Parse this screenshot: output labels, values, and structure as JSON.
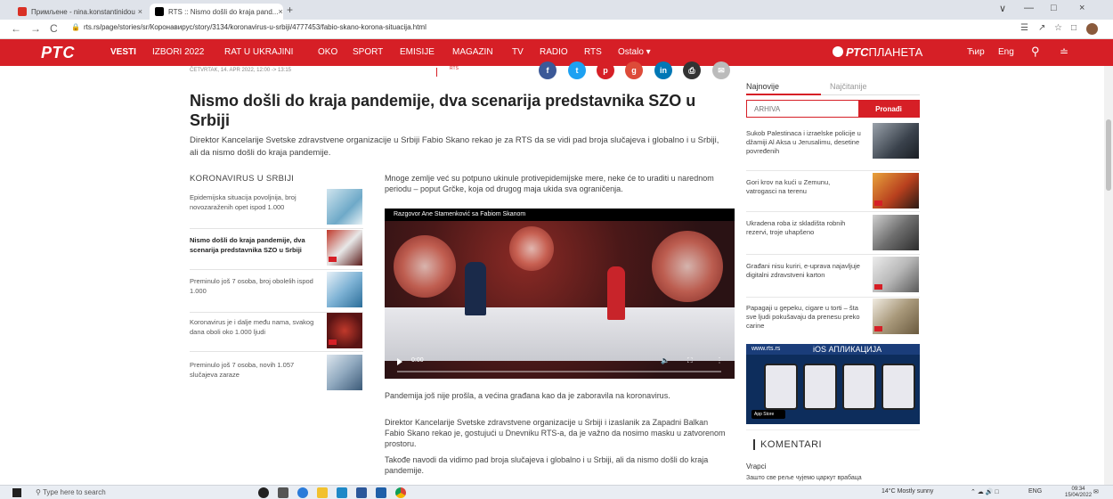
{
  "browser": {
    "tabs": [
      {
        "title": "Примљене - nina.konstantinidou",
        "favicon_color": "#d93025",
        "active": false
      },
      {
        "title": "RTS :: Nismo došli do kraja pand...",
        "favicon_color": "#000000",
        "active": true
      }
    ],
    "url": "rts.rs/page/stories/sr/Коронавирус/story/3134/koronavirus-u-srbiji/4777453/fabio-skano-korona-situacija.html",
    "new_tab": "+",
    "tab_close": "×",
    "nav": {
      "back": "←",
      "forward": "→",
      "reload": "C"
    },
    "window_controls": {
      "min": "—",
      "max": "□",
      "close": "×",
      "down": "∨"
    }
  },
  "site": {
    "logo": "РТС",
    "menu": [
      "VESTI",
      "IZBORI 2022",
      "RAT U UKRAJINI",
      "OKO",
      "SPORT",
      "EMISIJE",
      "MAGAZIN",
      "TV",
      "RADIO",
      "RTS",
      "Ostalo ▾"
    ],
    "active_menu": "VESTI",
    "planeta_brand": "РТС",
    "planeta_suffix": "ПЛАНЕТА",
    "lang_cyr": "Ћир",
    "lang_eng": "Eng",
    "accent_color": "#d61f26"
  },
  "article": {
    "dateline": "ČETVRTAK, 14. APR 2022, 12:00 -> 13:15",
    "share_label": "RTS",
    "share_icons": [
      "facebook-icon",
      "twitter-icon",
      "pinterest-icon",
      "googleplus-icon",
      "linkedin-icon",
      "print-icon",
      "email-icon"
    ],
    "headline": "Nismo došli do kraja pandemije, dva scenarija predstavnika SZO u Srbiji",
    "lead": "Direktor Kancelarije Svetske zdravstvene organizacije u Srbiji Fabio Skano rekao je za RTS da se vidi pad broja slučajeva i globalno i u Srbiji, ali da nismo došli do kraja pandemije.",
    "intro": "Mnoge zemlje već su potpuno ukinule protivepidemijske mere, neke će to uraditi u narednom periodu – poput Grčke, koja od drugog maja ukida sva ograničenja.",
    "video": {
      "title": "Razgovor Ane Stamenković sa Fabiom Skanom",
      "time": "0:00"
    },
    "paragraphs": [
      "Pandemija još nije prošla, a većina građana kao da je zaboravila na koronavirus.",
      "Direktor Kancelarije Svetske zdravstvene organizacije u Srbiji i izaslanik za Zapadni Balkan Fabio Skano rekao je, gostujući u Dnevniku RTS-a, da je važno da nosimo masku u zatvorenom prostoru.",
      "Takođe navodi da vidimo pad broja slučajeva i globalno i u Srbiji, ali da nismo došli do kraja pandemije."
    ]
  },
  "related": {
    "title": "KORONAVIRUS U SRBIJI",
    "items": [
      {
        "text": "Epidemijska situacija povoljnija, broj novozaraženih opet ispod 1.000",
        "bold": false
      },
      {
        "text": "Nismo došli do kraja pandemije, dva scenarija predstavnika SZO u Srbiji",
        "bold": true
      },
      {
        "text": "Preminulo još 7 osoba, broj obolelih ispod 1.000",
        "bold": false
      },
      {
        "text": "Koronavirus je i dalje među nama, svakog dana oboli oko 1.000 ljudi",
        "bold": false
      },
      {
        "text": "Preminulo još 7 osoba, novih 1.057 slučajeva zaraze",
        "bold": false
      }
    ]
  },
  "sidebar": {
    "tab_latest": "Najnovije",
    "tab_most_read": "Najčitanije",
    "archive_placeholder": "ARHIVA",
    "archive_button": "Pronađi",
    "news": [
      "Sukob Palestinaca i izraelske policije u džamiji Al Aksa u Jerusalimu, desetine povređenih",
      "Gori krov na kući u Zemunu, vatrogasci na terenu",
      "Ukradena roba iz skladišta robnih rezervi, troje uhapšeno",
      "Građani nisu kuriri, e-uprava najavljuje digitalni zdravstveni karton",
      "Papagaji u gepeku, cigare u torti – šta sve ljudi pokušavaju da prenesu preko carine"
    ],
    "ios": {
      "site": "www.rts.rs",
      "title": "iOS АПЛИКАЦИЈА",
      "store": "App Store"
    },
    "comments_title": "KOMENTARI",
    "comment_author": "Vrapci",
    "comment_text": "Зашто све реље чујемо царкут врабаца"
  },
  "taskbar": {
    "search_placeholder": "Type here to search",
    "weather": "14°C  Mostly sunny",
    "lang": "ENG",
    "time": "09:34",
    "date": "15/04/2022"
  }
}
